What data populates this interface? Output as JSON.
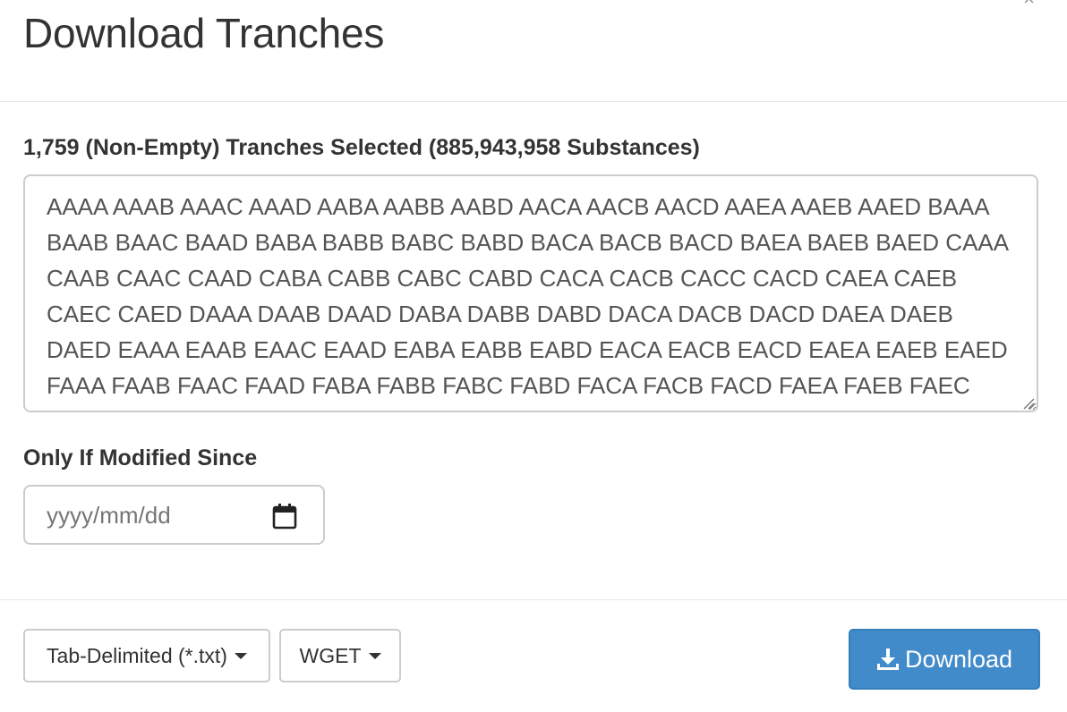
{
  "header": {
    "title": "Download Tranches",
    "close_glyph": "×"
  },
  "body": {
    "selected_label": "1,759 (Non-Empty) Tranches Selected (885,943,958 Substances)",
    "tranches_text": "AAAA AAAB AAAC AAAD AABA AABB AABD AACA AACB AACD AAEA AAEB AAED BAAA BAAB BAAC BAAD BABA BABB BABC BABD BACA BACB BACD BAEA BAEB BAED CAAA CAAB CAAC CAAD CABA CABB CABC CABD CACA CACB CACC CACD CAEA CAEB CAEC CAED DAAA DAAB DAAD DABA DABB DABD DACA DACB DACD DAEA DAEB DAED EAAA EAAB EAAC EAAD EABA EABB EABD EACA EACB EACD EAEA EAEB EAED FAAA FAAB FAAC FAAD FABA FABB FABC FABD FACA FACB FACD FAEA FAEB FAEC FAED GAAA GAAB GAAC GAAD GABA GABB GABD",
    "date_label": "Only If Modified Since",
    "date_placeholder": "yyyy/mm/dd",
    "calendar_icon": "calendar-icon"
  },
  "footer": {
    "format_label": "Tab-Delimited (*.txt)",
    "method_label": "WGET",
    "download_label": "Download",
    "download_icon": "download-icon",
    "primary_color": "#428bca"
  }
}
